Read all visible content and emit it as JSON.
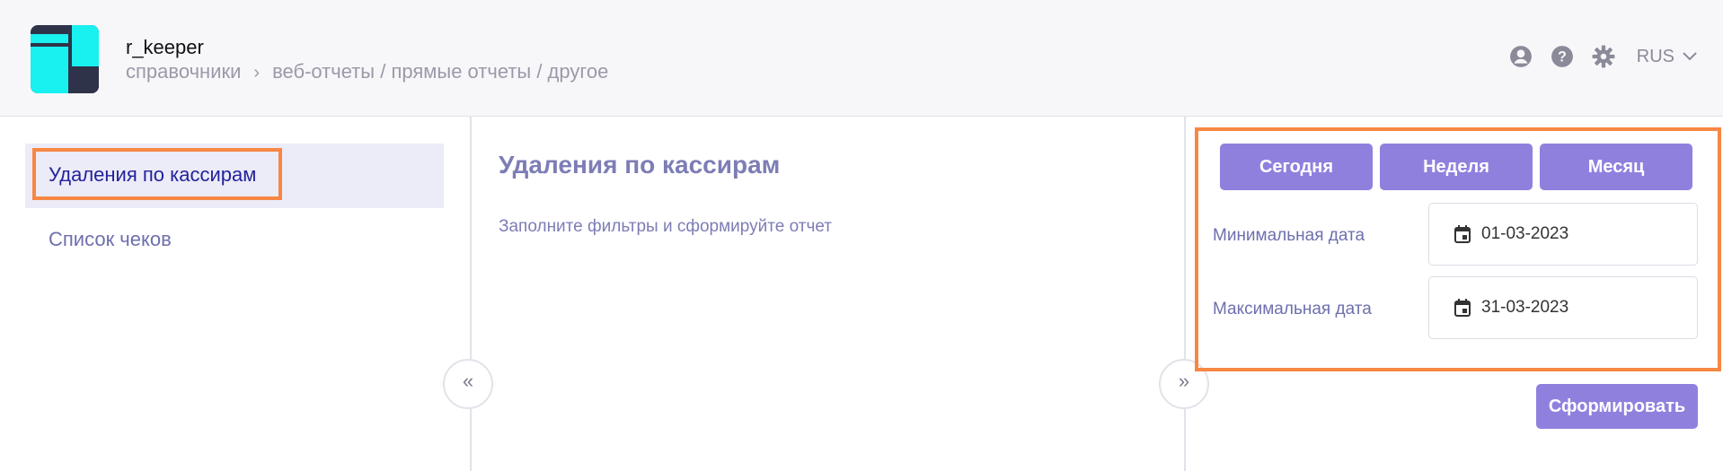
{
  "header": {
    "app_title": "r_keeper",
    "breadcrumb": {
      "root": "справочники",
      "separator": "›",
      "path": "веб-отчеты / прямые отчеты / другое"
    },
    "icons": [
      "user-icon",
      "help-icon",
      "settings-icon"
    ],
    "language": "RUS"
  },
  "sidebar": {
    "items": [
      {
        "label": "Удаления по кассирам",
        "active": true
      },
      {
        "label": "Список чеков",
        "active": false
      }
    ]
  },
  "main": {
    "title": "Удаления по кассирам",
    "hint": "Заполните фильтры и сформируйте отчет"
  },
  "filters": {
    "quick_ranges": [
      "Сегодня",
      "Неделя",
      "Месяц"
    ],
    "min_date_label": "Минимальная дата",
    "min_date_value": "01-03-2023",
    "max_date_label": "Максимальная дата",
    "max_date_value": "31-03-2023",
    "submit_label": "Сформировать"
  },
  "collapse": {
    "left": "«",
    "right": "»"
  },
  "colors": {
    "accent": "#9080de",
    "highlight": "#f78743",
    "logo_bg": "#2f3349",
    "logo_fg": "#19f0f0"
  }
}
